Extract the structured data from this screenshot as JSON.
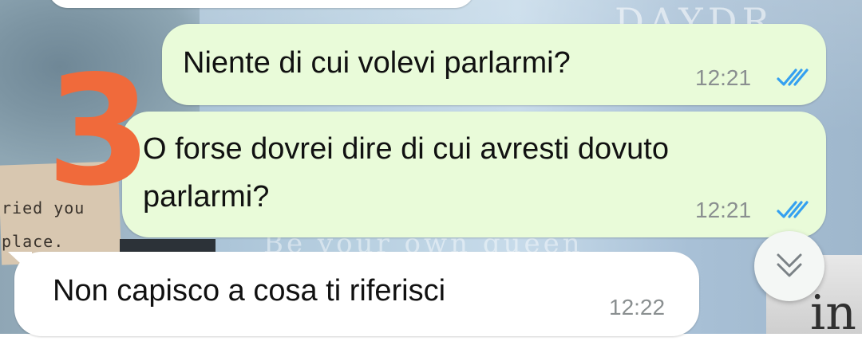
{
  "wallpaper": {
    "paper_text_line1": "ried you",
    "paper_text_line2": "place.",
    "top_letters": "DAYDR",
    "faded_text": "Be your own queen",
    "corner_letters": "in"
  },
  "annotation": {
    "number": "3"
  },
  "messages": [
    {
      "direction": "outgoing",
      "text": "Niente di cui volevi parlarmi?",
      "time": "12:21",
      "status": "read-double-tick"
    },
    {
      "direction": "outgoing",
      "text_line1": "O forse dovrei dire di cui avresti dovuto",
      "text_line2": "parlarmi?",
      "time": "12:21",
      "status": "read-double-tick"
    },
    {
      "direction": "incoming",
      "text": "Non capisco a cosa ti riferisci",
      "time": "12:22"
    }
  ],
  "colors": {
    "outgoing_bubble": "#e9fbd9",
    "incoming_bubble": "#ffffff",
    "read_ticks": "#34a0f0",
    "annotation": "#f06a3b"
  },
  "icons": {
    "read_status": "double-check-icon",
    "scroll_down": "double-chevron-down-icon"
  }
}
